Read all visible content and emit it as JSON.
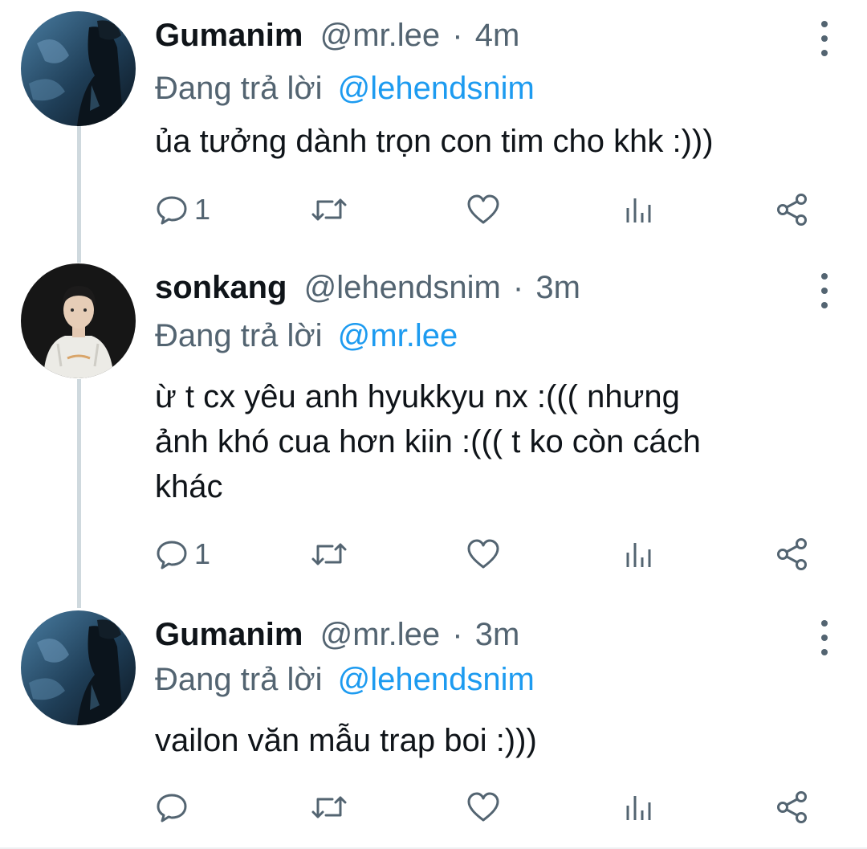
{
  "tweets": [
    {
      "name": "Gumanim",
      "handle": "@mr.lee",
      "separator": "·",
      "time": "4m",
      "reply_prefix": "Đang trả lời",
      "reply_to": "@lehendsnim",
      "text": "ủa tưởng dành trọn con tim cho khk :)))",
      "reply_count": "1",
      "avatar": "dark-blue-photo-avatar"
    },
    {
      "name": "sonkang",
      "handle": "@lehendsnim",
      "separator": "·",
      "time": "3m",
      "reply_prefix": "Đang trả lời",
      "reply_to": "@mr.lee",
      "text_lines": [
        "ừ t cx yêu anh hyukkyu nx :((( nhưng",
        "ảnh khó cua hơn kiin :((( t ko còn cách",
        "khác"
      ],
      "reply_count": "1",
      "avatar": "person-white-shirt-avatar"
    },
    {
      "name": "Gumanim",
      "handle": "@mr.lee",
      "separator": "·",
      "time": "3m",
      "reply_prefix": "Đang trả lời",
      "reply_to": "@lehendsnim",
      "text": "vailon văn mẫu trap boi :)))",
      "reply_count": "",
      "avatar": "dark-blue-photo-avatar"
    }
  ],
  "icons": [
    "reply-icon",
    "retweet-icon",
    "like-icon",
    "analytics-icon",
    "share-icon",
    "more-options-icon"
  ],
  "colors": {
    "text": "#0f1419",
    "secondary": "#536471",
    "mention": "#1d9bf0",
    "thread_line": "#cfd9de"
  }
}
